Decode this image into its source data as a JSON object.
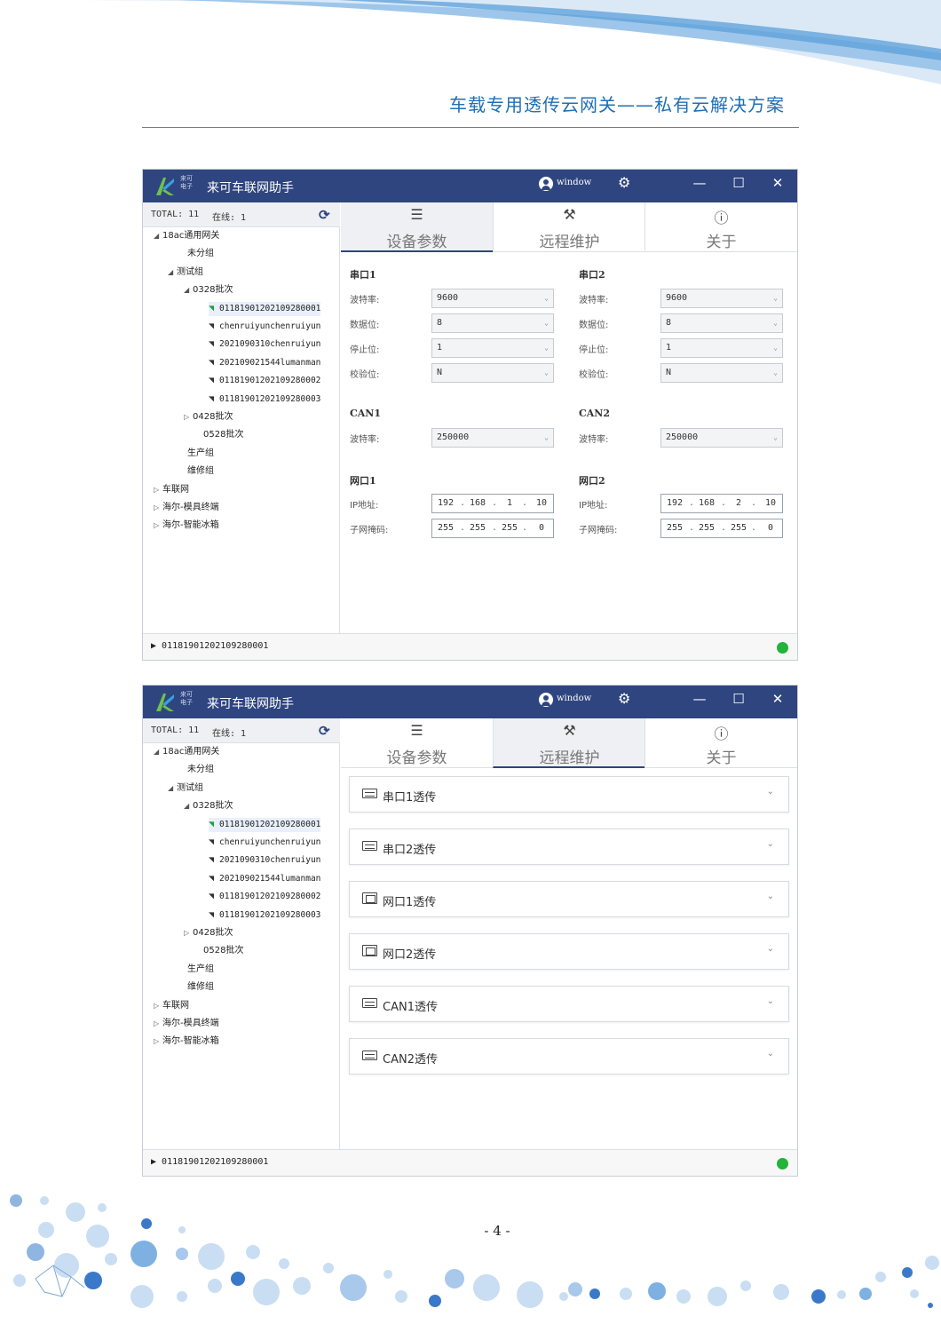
{
  "doc": {
    "title": "车载专用透传云网关——私有云解决方案",
    "page_number": "- 4 -"
  },
  "app": {
    "logo_sub": "来可电子",
    "title": "来可车联网助手",
    "user": "window",
    "window_controls": {
      "minimize": "—",
      "maximize": "☐",
      "close": "✕"
    }
  },
  "stats": {
    "total": "TOTAL: 11",
    "online": "在线: 1"
  },
  "tree": [
    {
      "label": "18ac通用网关",
      "expander": "◢"
    },
    {
      "label": "未分组",
      "expander": ""
    },
    {
      "label": "测试组",
      "expander": "◢"
    },
    {
      "label": "0328批次",
      "expander": "◢"
    },
    {
      "label": "01181901202109280001",
      "online": true
    },
    {
      "label": "chenruiyunchenruiyun",
      "online": false
    },
    {
      "label": "2021090310chenruiyun",
      "online": false
    },
    {
      "label": "202109021544lumanman",
      "online": false
    },
    {
      "label": "01181901202109280002",
      "online": false
    },
    {
      "label": "01181901202109280003",
      "online": false
    },
    {
      "label": "0428批次",
      "expander": "▷"
    },
    {
      "label": "0528批次",
      "expander": ""
    },
    {
      "label": "生产组",
      "expander": ""
    },
    {
      "label": "维修组",
      "expander": ""
    },
    {
      "label": "车联网",
      "expander": "▷"
    },
    {
      "label": "海尔-模具终端",
      "expander": "▷"
    },
    {
      "label": "海尔-智能冰箱",
      "expander": "▷"
    }
  ],
  "selected_device": "01181901202109280001",
  "tabs": [
    {
      "icon": "☰",
      "label": "设备参数"
    },
    {
      "icon": "⚒",
      "label": "远程维护"
    },
    {
      "icon": "ⓘ",
      "label": "关于"
    }
  ],
  "params": {
    "serial1": {
      "title": "串口1",
      "baud_label": "波特率:",
      "baud": "9600",
      "data_label": "数据位:",
      "data": "8",
      "stop_label": "停止位:",
      "stop": "1",
      "parity_label": "校验位:",
      "parity": "N"
    },
    "serial2": {
      "title": "串口2",
      "baud_label": "波特率:",
      "baud": "9600",
      "data_label": "数据位:",
      "data": "8",
      "stop_label": "停止位:",
      "stop": "1",
      "parity_label": "校验位:",
      "parity": "N"
    },
    "can1": {
      "title": "CAN1",
      "baud_label": "波特率:",
      "baud": "250000"
    },
    "can2": {
      "title": "CAN2",
      "baud_label": "波特率:",
      "baud": "250000"
    },
    "net1": {
      "title": "网口1",
      "ip_label": "IP地址:",
      "ip": [
        "192",
        "168",
        "1",
        "10"
      ],
      "mask_label": "子网掩码:",
      "mask": [
        "255",
        "255",
        "255",
        "0"
      ]
    },
    "net2": {
      "title": "网口2",
      "ip_label": "IP地址:",
      "ip": [
        "192",
        "168",
        "2",
        "10"
      ],
      "mask_label": "子网掩码:",
      "mask": [
        "255",
        "255",
        "255",
        "0"
      ]
    }
  },
  "remote_items": [
    {
      "label": "串口1透传",
      "icon": "serial-port-icon"
    },
    {
      "label": "串口2透传",
      "icon": "serial-port-icon"
    },
    {
      "label": "网口1透传",
      "icon": "ethernet-port-icon"
    },
    {
      "label": "网口2透传",
      "icon": "ethernet-port-icon"
    },
    {
      "label": "CAN1透传",
      "icon": "serial-port-icon"
    },
    {
      "label": "CAN2透传",
      "icon": "serial-port-icon"
    }
  ],
  "colors": {
    "titlebar": "#2f4580",
    "online_status": "#23b33a",
    "doc_title": "#1f6fb5"
  }
}
